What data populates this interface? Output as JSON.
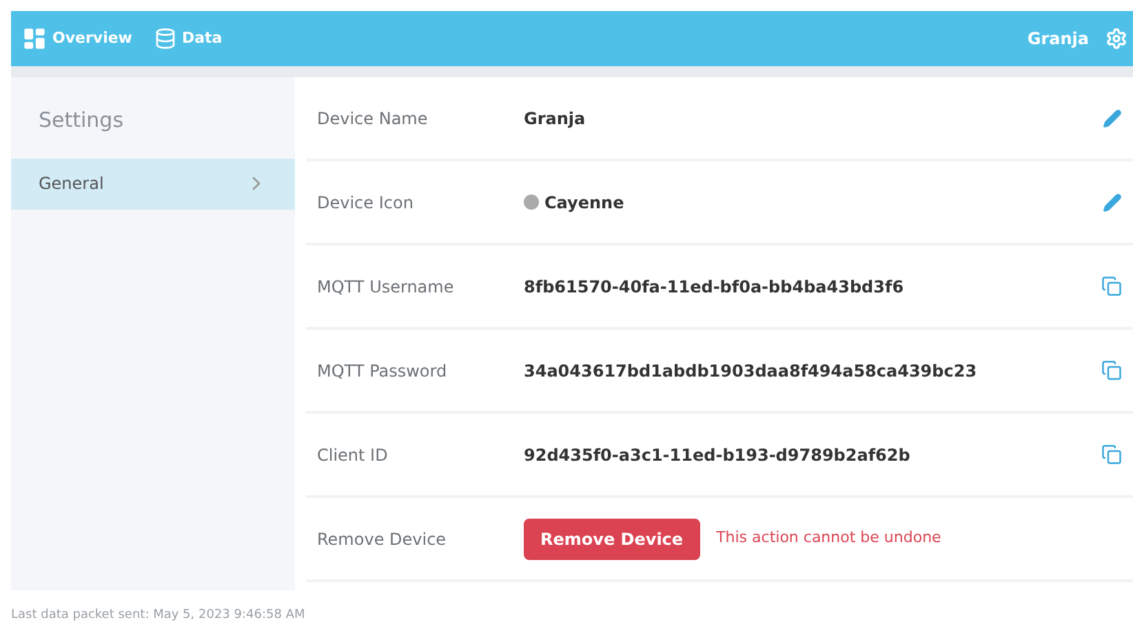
{
  "header": {
    "nav": [
      {
        "label": "Overview",
        "kind": "overview"
      },
      {
        "label": "Data",
        "kind": "data"
      }
    ],
    "device": "Granja"
  },
  "sidebar": {
    "title": "Settings",
    "items": [
      {
        "label": "General",
        "selected": true
      }
    ]
  },
  "rows": [
    {
      "label": "Device Name",
      "value": "Granja",
      "kind": "edit"
    },
    {
      "label": "Device Icon",
      "value": "Cayenne",
      "kind": "edit",
      "has_icon": true
    },
    {
      "label": "MQTT Username",
      "value": "8fb61570-40fa-11ed-bf0a-bb4ba43bd3f6",
      "kind": "copy"
    },
    {
      "label": "MQTT Password",
      "value": "34a043617bd1abdb1903daa8f494a58ca439bc23",
      "kind": "copy"
    },
    {
      "label": "Client ID",
      "value": "92d435f0-a3c1-11ed-b193-d9789b2af62b",
      "kind": "copy"
    },
    {
      "label": "Remove Device",
      "kind": "danger",
      "button": "Remove Device",
      "warning": "This action cannot be undone"
    }
  ],
  "footer": "Last data packet sent: May 5, 2023 9:46:58 AM"
}
